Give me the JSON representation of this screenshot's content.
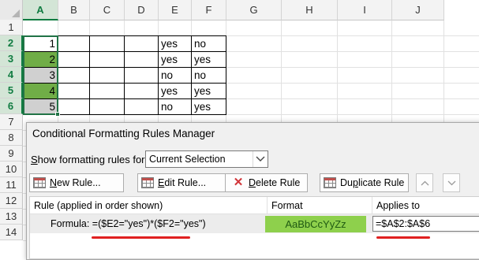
{
  "columns": [
    "A",
    "B",
    "C",
    "D",
    "E",
    "F",
    "G",
    "H",
    "I",
    "J"
  ],
  "rows": [
    "1",
    "2",
    "3",
    "4",
    "5",
    "6",
    "7",
    "8",
    "9",
    "10",
    "11",
    "12",
    "13",
    "14"
  ],
  "selected_column": "A",
  "cells": {
    "A": [
      "1",
      "2",
      "3",
      "4",
      "5"
    ],
    "E": [
      "yes",
      "yes",
      "no",
      "yes",
      "no"
    ],
    "F": [
      "no",
      "yes",
      "no",
      "yes",
      "yes"
    ]
  },
  "cell_fill": [
    "none",
    "green",
    "gray",
    "green",
    "gray"
  ],
  "colors": {
    "green_fill": "#70ad47",
    "gray_fill": "#d0d0d0",
    "selection": "#217346",
    "format_preview": "#8ed04c",
    "annotation": "#e02020"
  },
  "dialog": {
    "title": "Conditional Formatting Rules Manager",
    "show_label": "Show formatting rules for:",
    "show_label_key": "S",
    "show_label_rest": "how formatting rules for:",
    "scope_value": "Current Selection",
    "buttons": {
      "new_rule": "New Rule...",
      "new_rule_key": "N",
      "new_rule_rest": "ew Rule...",
      "edit_rule": "Edit Rule...",
      "edit_rule_key": "E",
      "edit_rule_rest": "dit Rule...",
      "delete_rule": "Delete Rule",
      "delete_rule_key": "D",
      "delete_rule_rest": "elete Rule",
      "duplicate_rule": "Duplicate Rule",
      "duplicate_rule_pre": "Du",
      "duplicate_rule_key": "p",
      "duplicate_rule_rest": "licate Rule"
    },
    "icons": {
      "new_rule": "table-grid-icon",
      "edit_rule": "table-edit-icon",
      "delete_rule": "delete-x-icon",
      "move_up": "chevron-up-icon",
      "move_down": "chevron-down-icon"
    },
    "headers": {
      "rule": "Rule (applied in order shown)",
      "format": "Format",
      "applies_to": "Applies to"
    },
    "rule": {
      "text": "Formula: =($E2=\"yes\")*($F2=\"yes\")",
      "format_sample": "AaBbCcYyZz",
      "applies_to": "=$A$2:$A$6"
    }
  }
}
